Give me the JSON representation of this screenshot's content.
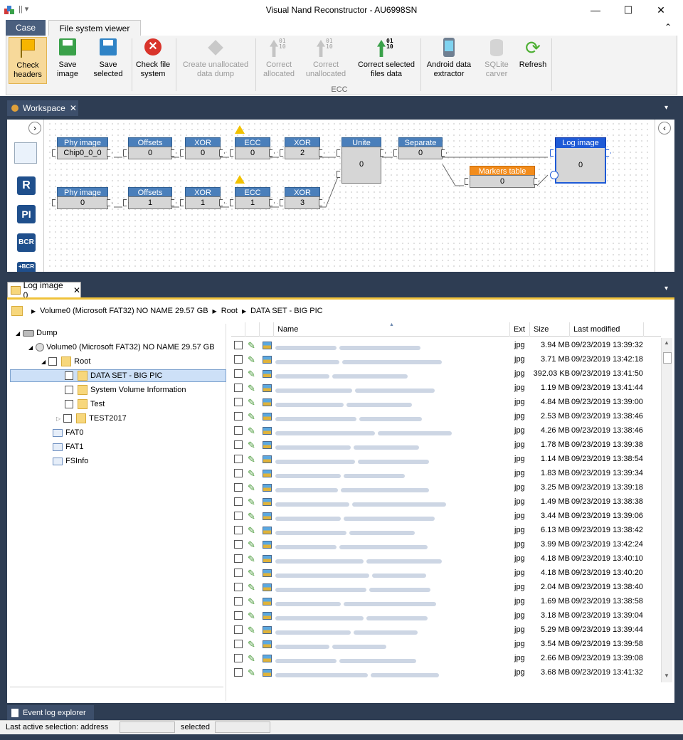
{
  "window": {
    "title": "Visual Nand Reconstructor - AU6998SN",
    "minimize": "—",
    "maximize": "☐",
    "close": "✕"
  },
  "ribbon": {
    "tabs": [
      "Case",
      "File system viewer"
    ],
    "collapse": "⌃",
    "buttons": [
      {
        "line1": "Check",
        "line2": "headers",
        "icon": "check-headers-icon"
      },
      {
        "line1": "Save",
        "line2": "image",
        "icon": "floppy-icon"
      },
      {
        "line1": "Save",
        "line2": "selected",
        "icon": "floppy-icon"
      },
      {
        "line1": "Check file",
        "line2": "system",
        "icon": "check-fs-icon"
      },
      {
        "line1": "Create unallocated",
        "line2": "data dump",
        "icon": "cubes-icon"
      },
      {
        "line1": "Correct",
        "line2": "allocated",
        "icon": "arrow-binary-icon"
      },
      {
        "line1": "Correct",
        "line2": "unallocated",
        "icon": "arrow-binary-icon"
      },
      {
        "line1": "Correct selected",
        "line2": "files data",
        "icon": "green-arrow-binary-icon"
      },
      {
        "line1": "Android data",
        "line2": "extractor",
        "icon": "android-icon"
      },
      {
        "line1": "SQLite",
        "line2": "carver",
        "icon": "database-icon"
      },
      {
        "line1": "Refresh",
        "line2": "",
        "icon": "refresh-icon"
      }
    ],
    "ecc_group": "ECC"
  },
  "workspace": {
    "tab": "Workspace",
    "side_icons": [
      "R",
      "PI",
      "BCR",
      "+BCR"
    ],
    "blocks": [
      {
        "title": "Phy image",
        "value": "Chip0_0_0"
      },
      {
        "title": "Offsets",
        "value": "0"
      },
      {
        "title": "XOR",
        "value": "0"
      },
      {
        "title": "ECC",
        "value": "0"
      },
      {
        "title": "XOR",
        "value": "2"
      },
      {
        "title": "Unite",
        "value": "0"
      },
      {
        "title": "Separate",
        "value": "0"
      },
      {
        "title": "Log image",
        "value": "0"
      },
      {
        "title": "Phy image",
        "value": "0"
      },
      {
        "title": "Offsets",
        "value": "1"
      },
      {
        "title": "XOR",
        "value": "1"
      },
      {
        "title": "ECC",
        "value": "1"
      },
      {
        "title": "XOR",
        "value": "3"
      },
      {
        "title": "Markers table",
        "value": "0"
      }
    ]
  },
  "log_image": {
    "tab": "Log image 0",
    "breadcrumb": [
      "Volume0 (Microsoft FAT32) NO NAME  29.57 GB",
      "Root",
      "DATA SET - BIG PIC"
    ],
    "tree": [
      {
        "label": "Dump"
      },
      {
        "label": "Volume0 (Microsoft FAT32) NO NAME  29.57 GB"
      },
      {
        "label": "Root"
      },
      {
        "label": "DATA SET - BIG PIC"
      },
      {
        "label": "System Volume Information"
      },
      {
        "label": "Test"
      },
      {
        "label": "TEST2017"
      },
      {
        "label": "FAT0"
      },
      {
        "label": "FAT1"
      },
      {
        "label": "FSInfo"
      }
    ],
    "columns": [
      "Name",
      "Ext",
      "Size",
      "Last modified"
    ],
    "rows": [
      {
        "ext": "jpg",
        "size": "3.94 MB",
        "modified": "09/23/2019 13:39:32"
      },
      {
        "ext": "jpg",
        "size": "3.71 MB",
        "modified": "09/23/2019 13:42:18"
      },
      {
        "ext": "jpg",
        "size": "392.03 KB",
        "modified": "09/23/2019 13:41:50"
      },
      {
        "ext": "jpg",
        "size": "1.19 MB",
        "modified": "09/23/2019 13:41:44"
      },
      {
        "ext": "jpg",
        "size": "4.84 MB",
        "modified": "09/23/2019 13:39:00"
      },
      {
        "ext": "jpg",
        "size": "2.53 MB",
        "modified": "09/23/2019 13:38:46"
      },
      {
        "ext": "jpg",
        "size": "4.26 MB",
        "modified": "09/23/2019 13:38:46"
      },
      {
        "ext": "jpg",
        "size": "1.78 MB",
        "modified": "09/23/2019 13:39:38"
      },
      {
        "ext": "jpg",
        "size": "1.14 MB",
        "modified": "09/23/2019 13:38:54"
      },
      {
        "ext": "jpg",
        "size": "1.83 MB",
        "modified": "09/23/2019 13:39:34"
      },
      {
        "ext": "jpg",
        "size": "3.25 MB",
        "modified": "09/23/2019 13:39:18"
      },
      {
        "ext": "jpg",
        "size": "1.49 MB",
        "modified": "09/23/2019 13:38:38"
      },
      {
        "ext": "jpg",
        "size": "3.44 MB",
        "modified": "09/23/2019 13:39:06"
      },
      {
        "ext": "jpg",
        "size": "6.13 MB",
        "modified": "09/23/2019 13:38:42"
      },
      {
        "ext": "jpg",
        "size": "3.99 MB",
        "modified": "09/23/2019 13:42:24"
      },
      {
        "ext": "jpg",
        "size": "4.18 MB",
        "modified": "09/23/2019 13:40:10"
      },
      {
        "ext": "jpg",
        "size": "4.18 MB",
        "modified": "09/23/2019 13:40:20"
      },
      {
        "ext": "jpg",
        "size": "2.04 MB",
        "modified": "09/23/2019 13:38:40"
      },
      {
        "ext": "jpg",
        "size": "1.69 MB",
        "modified": "09/23/2019 13:38:58"
      },
      {
        "ext": "jpg",
        "size": "3.18 MB",
        "modified": "09/23/2019 13:39:04"
      },
      {
        "ext": "jpg",
        "size": "5.29 MB",
        "modified": "09/23/2019 13:39:44"
      },
      {
        "ext": "jpg",
        "size": "3.54 MB",
        "modified": "09/23/2019 13:39:58"
      },
      {
        "ext": "jpg",
        "size": "2.66 MB",
        "modified": "09/23/2019 13:39:08"
      },
      {
        "ext": "jpg",
        "size": "3.68 MB",
        "modified": "09/23/2019 13:41:32"
      }
    ]
  },
  "event_log": {
    "tab": "Event log explorer"
  },
  "status": {
    "address_label": "Last active selection:  address",
    "selected_label": "selected"
  },
  "colors": {
    "frame": "#2e3d53",
    "accent": "#f0c23a",
    "block_header": "#4a7fbb",
    "markers_header": "#f28c1c",
    "log_selected": "#1e5ad6"
  }
}
